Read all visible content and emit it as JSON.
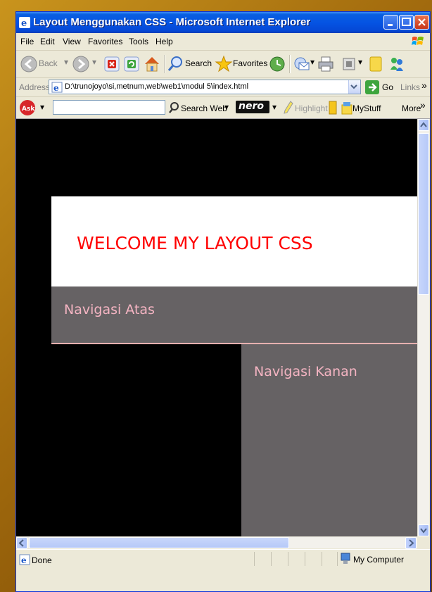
{
  "window": {
    "title": "Layout Menggunakan CSS - Microsoft Internet Explorer"
  },
  "menu": {
    "items": [
      "File",
      "Edit",
      "View",
      "Favorites",
      "Tools",
      "Help"
    ]
  },
  "toolbar": {
    "back_label": "Back",
    "search_label": "Search",
    "favorites_label": "Favorites"
  },
  "address": {
    "label": "Address",
    "url": "D:\\trunojoyo\\si,metnum,web\\web1\\modul 5\\index.html",
    "go_label": "Go",
    "links_label": "Links"
  },
  "askbar": {
    "search_web_label": "Search Web",
    "nero_label": "nero",
    "highlight_label": "Highlight",
    "mystuff_label": "MyStuff",
    "more_label": "More"
  },
  "page": {
    "header_title": "WELCOME MY LAYOUT CSS",
    "nav_top_label": "Navigasi Atas",
    "nav_right_label": "Navigasi Kanan"
  },
  "status": {
    "left_text": "Done",
    "zone_text": "My Computer"
  },
  "colors": {
    "header_title": "#ff0000",
    "nav_bg": "#666264",
    "nav_text": "#f4b4c2",
    "titlebar": "#0554e3"
  }
}
